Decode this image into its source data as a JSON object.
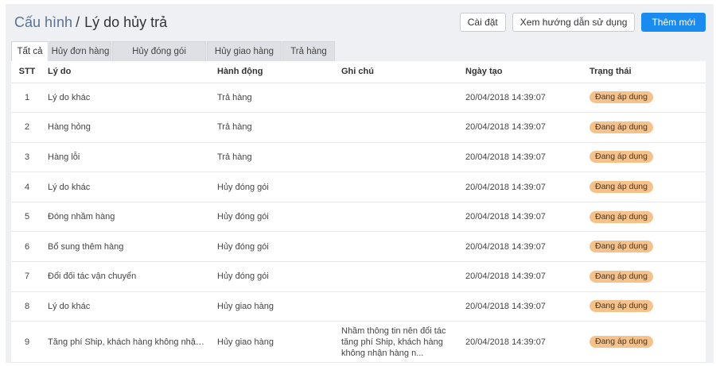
{
  "breadcrumb": {
    "root": "Cấu hình",
    "separator": "/",
    "current": "Lý do hủy trả"
  },
  "toolbar": {
    "settings_label": "Cài đặt",
    "guide_label": "Xem hướng dẫn sử dụng",
    "add_label": "Thêm mới"
  },
  "colors": {
    "primary": "#1a8cf0",
    "badge": "#f6c28b",
    "background": "#eef0f3"
  },
  "tabs": [
    {
      "label": "Tất cả",
      "active": true
    },
    {
      "label": "Hủy đơn hàng",
      "active": false
    },
    {
      "label": "Hủy đóng gói",
      "active": false
    },
    {
      "label": "Hủy giao hàng",
      "active": false
    },
    {
      "label": "Trả hàng",
      "active": false
    }
  ],
  "table": {
    "columns": [
      "STT",
      "Lý do",
      "Hành động",
      "Ghi chú",
      "Ngày tạo",
      "Trạng thái"
    ],
    "rows": [
      {
        "stt": "1",
        "reason": "Lý do khác",
        "action": "Trả hàng",
        "note": "",
        "created": "20/04/2018 14:39:07",
        "status": "Đang áp dụng"
      },
      {
        "stt": "2",
        "reason": "Hàng hỏng",
        "action": "Trả hàng",
        "note": "",
        "created": "20/04/2018 14:39:07",
        "status": "Đang áp dụng"
      },
      {
        "stt": "3",
        "reason": "Hàng lỗi",
        "action": "Trả hàng",
        "note": "",
        "created": "20/04/2018 14:39:07",
        "status": "Đang áp dụng"
      },
      {
        "stt": "4",
        "reason": "Lý do khác",
        "action": "Hủy đóng gói",
        "note": "",
        "created": "20/04/2018 14:39:07",
        "status": "Đang áp dụng"
      },
      {
        "stt": "5",
        "reason": "Đóng nhầm hàng",
        "action": "Hủy đóng gói",
        "note": "",
        "created": "20/04/2018 14:39:07",
        "status": "Đang áp dụng"
      },
      {
        "stt": "6",
        "reason": "Bổ sung thêm hàng",
        "action": "Hủy đóng gói",
        "note": "",
        "created": "20/04/2018 14:39:07",
        "status": "Đang áp dụng"
      },
      {
        "stt": "7",
        "reason": "Đổi đối tác vận chuyển",
        "action": "Hủy đóng gói",
        "note": "",
        "created": "20/04/2018 14:39:07",
        "status": "Đang áp dụng"
      },
      {
        "stt": "8",
        "reason": "Lý do khác",
        "action": "Hủy giao hàng",
        "note": "",
        "created": "20/04/2018 14:39:07",
        "status": "Đang áp dụng"
      },
      {
        "stt": "9",
        "reason": "Tăng phí Ship, khách hàng không nhận hàn...",
        "action": "Hủy giao hàng",
        "note": "Nhầm thông tin nên đổi tác tăng phí Ship, khách hàng không nhận hàng n...",
        "created": "20/04/2018 14:39:07",
        "status": "Đang áp dụng"
      }
    ]
  }
}
